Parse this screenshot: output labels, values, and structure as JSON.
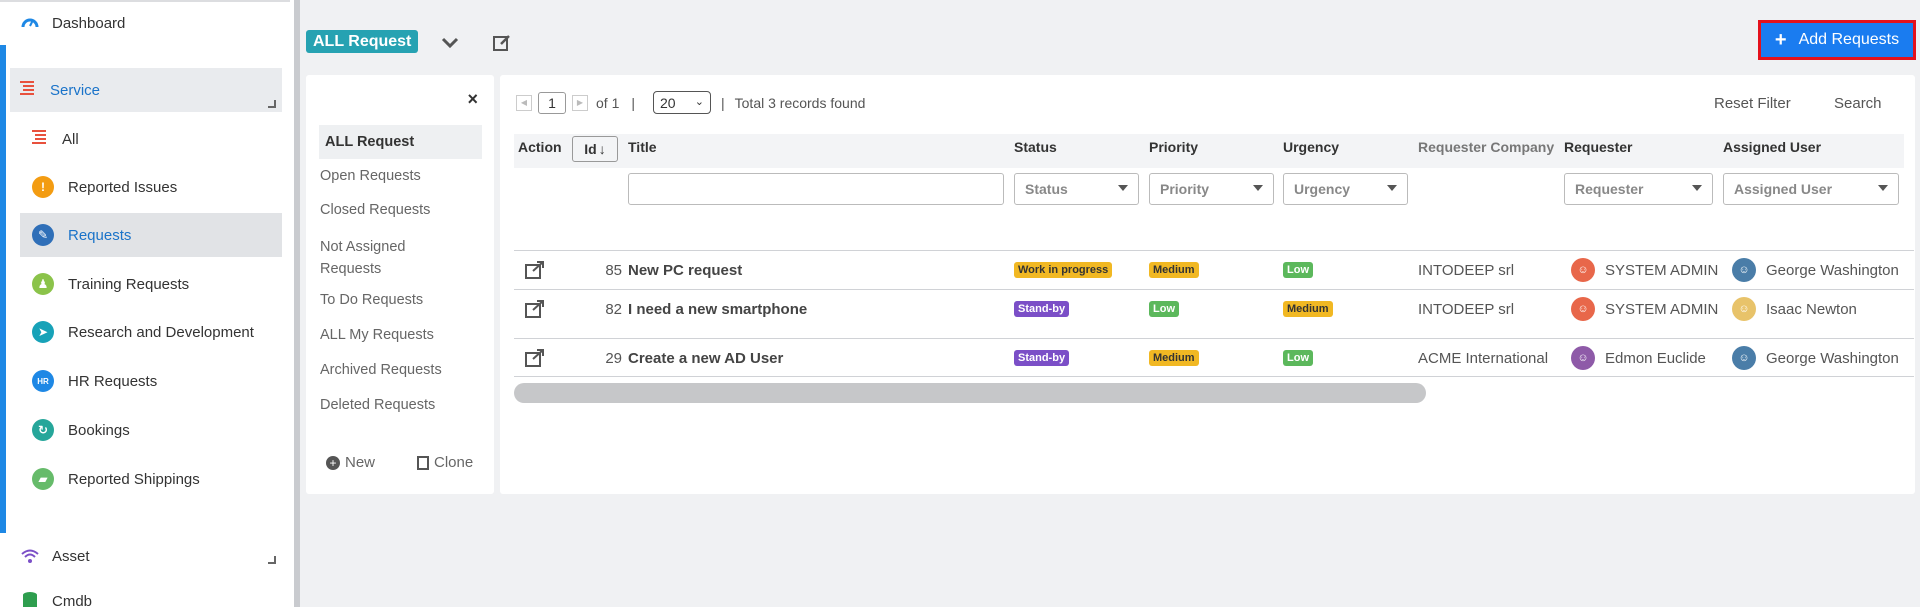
{
  "sidebar": {
    "dashboard": "Dashboard",
    "service": "Service",
    "items": [
      {
        "label": "All",
        "icon": "list-icon",
        "color": "#e8513d"
      },
      {
        "label": "Reported Issues",
        "icon": "exclamation-icon",
        "color": "#f39c12"
      },
      {
        "label": "Requests",
        "icon": "edit-icon",
        "color": "#2f6fb8"
      },
      {
        "label": "Training Requests",
        "icon": "training-icon",
        "color": "#8bc34a"
      },
      {
        "label": "Research and Development",
        "icon": "research-icon",
        "color": "#17a2b8"
      },
      {
        "label": "HR Requests",
        "icon": "hr-icon",
        "color": "#1e88e5",
        "text": "HR"
      },
      {
        "label": "Bookings",
        "icon": "bookings-icon",
        "color": "#26a69a"
      },
      {
        "label": "Reported Shippings",
        "icon": "shipping-icon",
        "color": "#66bb6a"
      }
    ],
    "asset": "Asset",
    "cmdb": "Cmdb"
  },
  "toolbar": {
    "view_name": "ALL Request",
    "add_button": "Add Requests",
    "add_plus": "+"
  },
  "views": {
    "close": "×",
    "links": [
      "ALL Request",
      "Open Requests",
      "Closed Requests",
      "Not Assigned Requests",
      "To Do Requests",
      "ALL My Requests",
      "Archived Requests",
      "Deleted Requests"
    ],
    "new": "New",
    "clone": "Clone"
  },
  "pager": {
    "page": "1",
    "of": "of 1",
    "sep": "|",
    "per_page": "20",
    "total": "Total 3 records found"
  },
  "actions": {
    "reset": "Reset Filter",
    "search": "Search"
  },
  "columns": {
    "action": "Action",
    "id": "Id",
    "title": "Title",
    "status": "Status",
    "priority": "Priority",
    "urgency": "Urgency",
    "company": "Requester Company",
    "requester": "Requester",
    "assigned": "Assigned User"
  },
  "filters": {
    "title": "",
    "status": "Status",
    "priority": "Priority",
    "urgency": "Urgency",
    "requester": "Requester",
    "assigned": "Assigned User"
  },
  "colors": {
    "work_in_progress": "#f1b823",
    "stand_by": "#7b4fc7",
    "medium": "#f1b823",
    "low": "#5cb85c",
    "accent": "#1a7cf0"
  },
  "rows": [
    {
      "id": "85",
      "title": "New PC request",
      "status": "Work in progress",
      "status_color": "#f1b823",
      "status_text": "#333",
      "priority": "Medium",
      "priority_color": "#f1b823",
      "priority_text": "#333",
      "urgency": "Low",
      "urgency_color": "#5cb85c",
      "urgency_text": "#fff",
      "company": "INTODEEP srl",
      "requester": "SYSTEM ADMIN",
      "requester_color": "#e8674a",
      "assigned": "George Washington",
      "assigned_color": "#4a7da8"
    },
    {
      "id": "82",
      "title": "I need a new smartphone",
      "status": "Stand-by",
      "status_color": "#7b4fc7",
      "status_text": "#fff",
      "priority": "Low",
      "priority_color": "#5cb85c",
      "priority_text": "#fff",
      "urgency": "Medium",
      "urgency_color": "#f1b823",
      "urgency_text": "#333",
      "company": "INTODEEP srl",
      "requester": "SYSTEM ADMIN",
      "requester_color": "#e8674a",
      "assigned": "Isaac Newton",
      "assigned_color": "#e8c36a"
    },
    {
      "id": "29",
      "title": "Create a new AD User",
      "status": "Stand-by",
      "status_color": "#7b4fc7",
      "status_text": "#fff",
      "priority": "Medium",
      "priority_color": "#f1b823",
      "priority_text": "#333",
      "urgency": "Low",
      "urgency_color": "#5cb85c",
      "urgency_text": "#fff",
      "company": "ACME International",
      "requester": "Edmon Euclide",
      "requester_color": "#8e5aa8",
      "assigned": "George Washington",
      "assigned_color": "#4a7da8"
    }
  ]
}
